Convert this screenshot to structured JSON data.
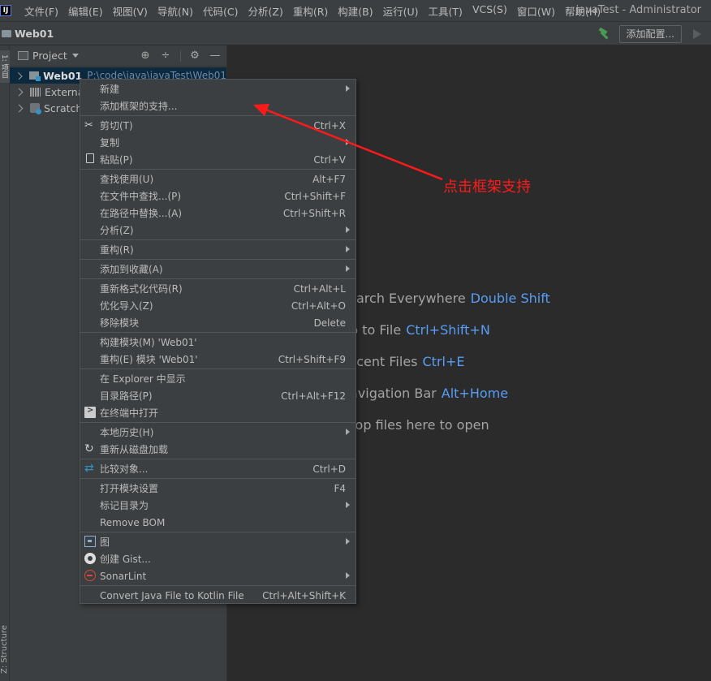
{
  "menubar": {
    "logo": "IJ",
    "items": [
      "文件(F)",
      "编辑(E)",
      "视图(V)",
      "导航(N)",
      "代码(C)",
      "分析(Z)",
      "重构(R)",
      "构建(B)",
      "运行(U)",
      "工具(T)",
      "VCS(S)",
      "窗口(W)",
      "帮助(H)"
    ],
    "window_title": "javaTest - Administrator"
  },
  "navbar": {
    "project": "Web01",
    "add_config": "添加配置..."
  },
  "tool_stripe": {
    "project_label": "1: 项目",
    "structure_label": "Z: Structure"
  },
  "project_panel": {
    "title": "Project",
    "tree": [
      {
        "name": "Web01",
        "path": "P:\\code\\java\\javaTest\\Web01",
        "icon": "module-folder-icon"
      },
      {
        "name": "External Libraries",
        "path": "",
        "icon": "library-icon"
      },
      {
        "name": "Scratches and Consoles",
        "path": "",
        "icon": "scratch-icon"
      }
    ]
  },
  "editor_hints": [
    {
      "text": "Search Everywhere",
      "key": "Double Shift"
    },
    {
      "text": "Go to File",
      "key": "Ctrl+Shift+N"
    },
    {
      "text": "Recent Files",
      "key": "Ctrl+E"
    },
    {
      "text": "Navigation Bar",
      "key": "Alt+Home"
    },
    {
      "text": "Drop files here to open",
      "key": ""
    }
  ],
  "annotation": {
    "text": "点击框架支持",
    "color": "#ff1a1a"
  },
  "context_menu": {
    "items": [
      {
        "label": "新建",
        "shortcut": "",
        "submenu": true
      },
      {
        "label": "添加框架的支持...",
        "shortcut": "",
        "submenu": false
      },
      {
        "label": "剪切(T)",
        "shortcut": "Ctrl+X",
        "submenu": false,
        "icon": "scissors-icon"
      },
      {
        "label": "复制",
        "shortcut": "",
        "submenu": true
      },
      {
        "label": "粘贴(P)",
        "shortcut": "Ctrl+V",
        "submenu": false,
        "icon": "clipboard-icon"
      },
      {
        "label": "查找使用(U)",
        "shortcut": "Alt+F7",
        "submenu": false
      },
      {
        "label": "在文件中查找...(P)",
        "shortcut": "Ctrl+Shift+F",
        "submenu": false
      },
      {
        "label": "在路径中替换...(A)",
        "shortcut": "Ctrl+Shift+R",
        "submenu": false
      },
      {
        "label": "分析(Z)",
        "shortcut": "",
        "submenu": true
      },
      {
        "label": "重构(R)",
        "shortcut": "",
        "submenu": true
      },
      {
        "label": "添加到收藏(A)",
        "shortcut": "",
        "submenu": true
      },
      {
        "label": "重新格式化代码(R)",
        "shortcut": "Ctrl+Alt+L",
        "submenu": false
      },
      {
        "label": "优化导入(Z)",
        "shortcut": "Ctrl+Alt+O",
        "submenu": false
      },
      {
        "label": "移除模块",
        "shortcut": "Delete",
        "submenu": false
      },
      {
        "label": "构建模块(M) 'Web01'",
        "shortcut": "",
        "submenu": false
      },
      {
        "label": "重构(E) 模块 'Web01'",
        "shortcut": "Ctrl+Shift+F9",
        "submenu": false
      },
      {
        "label": "在 Explorer 中显示",
        "shortcut": "",
        "submenu": false
      },
      {
        "label": "目录路径(P)",
        "shortcut": "Ctrl+Alt+F12",
        "submenu": false
      },
      {
        "label": "在终端中打开",
        "shortcut": "",
        "submenu": false,
        "icon": "terminal-icon"
      },
      {
        "label": "本地历史(H)",
        "shortcut": "",
        "submenu": true
      },
      {
        "label": "重新从磁盘加载",
        "shortcut": "",
        "submenu": false,
        "icon": "reload-icon"
      },
      {
        "label": "比较对象...",
        "shortcut": "Ctrl+D",
        "submenu": false,
        "icon": "compare-icon"
      },
      {
        "label": "打开模块设置",
        "shortcut": "F4",
        "submenu": false
      },
      {
        "label": "标记目录为",
        "shortcut": "",
        "submenu": true
      },
      {
        "label": "Remove BOM",
        "shortcut": "",
        "submenu": false
      },
      {
        "label": "图",
        "shortcut": "",
        "submenu": true,
        "icon": "diagram-icon"
      },
      {
        "label": "创建 Gist...",
        "shortcut": "",
        "submenu": false,
        "icon": "github-icon"
      },
      {
        "label": "SonarLint",
        "shortcut": "",
        "submenu": true,
        "icon": "sonarlint-icon"
      },
      {
        "label": "Convert Java File to Kotlin File",
        "shortcut": "Ctrl+Alt+Shift+K",
        "submenu": false
      }
    ]
  },
  "colors": {
    "chrome": "#3c3f41",
    "editor_bg": "#2b2b2b",
    "selection": "#0d293e",
    "shortcut_key": "#589df6",
    "annotation": "#ff1a1a"
  }
}
